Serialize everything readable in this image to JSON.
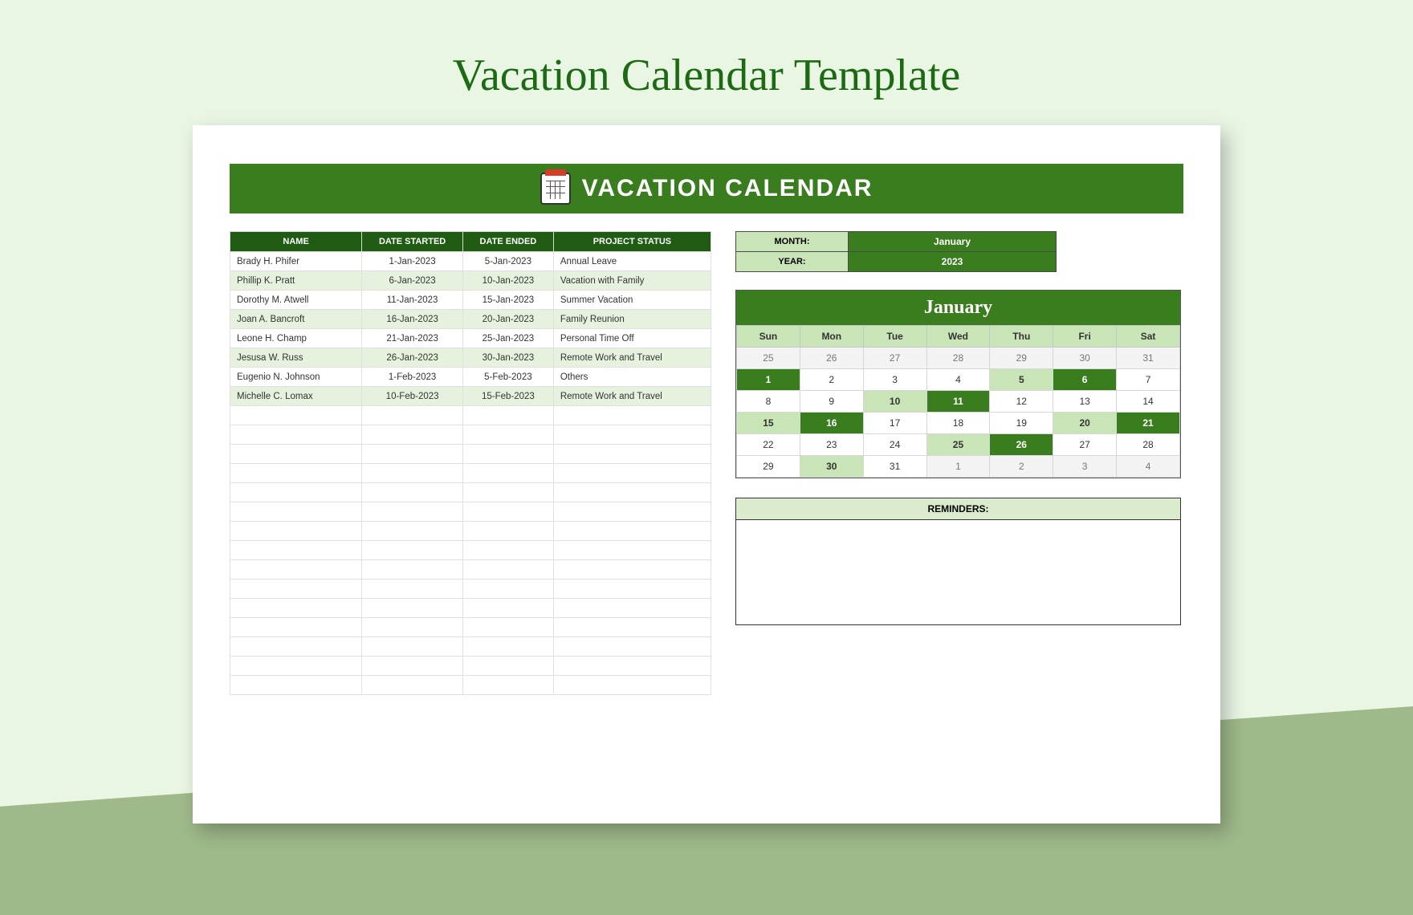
{
  "page_title": "Vacation Calendar Template",
  "banner_title": "VACATION CALENDAR",
  "table": {
    "headers": [
      "NAME",
      "DATE STARTED",
      "DATE ENDED",
      "PROJECT STATUS"
    ],
    "rows": [
      {
        "name": "Brady H. Phifer",
        "start": "1-Jan-2023",
        "end": "5-Jan-2023",
        "status": "Annual Leave"
      },
      {
        "name": "Phillip K. Pratt",
        "start": "6-Jan-2023",
        "end": "10-Jan-2023",
        "status": "Vacation with Family"
      },
      {
        "name": "Dorothy M. Atwell",
        "start": "11-Jan-2023",
        "end": "15-Jan-2023",
        "status": "Summer Vacation"
      },
      {
        "name": "Joan A. Bancroft",
        "start": "16-Jan-2023",
        "end": "20-Jan-2023",
        "status": "Family Reunion"
      },
      {
        "name": "Leone H. Champ",
        "start": "21-Jan-2023",
        "end": "25-Jan-2023",
        "status": "Personal Time Off"
      },
      {
        "name": "Jesusa W. Russ",
        "start": "26-Jan-2023",
        "end": "30-Jan-2023",
        "status": "Remote Work and Travel"
      },
      {
        "name": "Eugenio N. Johnson",
        "start": "1-Feb-2023",
        "end": "5-Feb-2023",
        "status": "Others"
      },
      {
        "name": "Michelle C. Lomax",
        "start": "10-Feb-2023",
        "end": "15-Feb-2023",
        "status": "Remote Work and Travel"
      }
    ],
    "empty_rows": 15
  },
  "meta": {
    "month_label": "MONTH:",
    "month_value": "January",
    "year_label": "YEAR:",
    "year_value": "2023"
  },
  "calendar": {
    "title": "January",
    "weekdays": [
      "Sun",
      "Mon",
      "Tue",
      "Wed",
      "Thu",
      "Fri",
      "Sat"
    ],
    "grid": [
      [
        {
          "d": "25",
          "cls": "dim"
        },
        {
          "d": "26",
          "cls": "dim"
        },
        {
          "d": "27",
          "cls": "dim"
        },
        {
          "d": "28",
          "cls": "dim"
        },
        {
          "d": "29",
          "cls": "dim"
        },
        {
          "d": "30",
          "cls": "dim"
        },
        {
          "d": "31",
          "cls": "dim"
        }
      ],
      [
        {
          "d": "1",
          "cls": "hl-dark"
        },
        {
          "d": "2",
          "cls": ""
        },
        {
          "d": "3",
          "cls": ""
        },
        {
          "d": "4",
          "cls": ""
        },
        {
          "d": "5",
          "cls": "hl-light"
        },
        {
          "d": "6",
          "cls": "hl-dark"
        },
        {
          "d": "7",
          "cls": ""
        }
      ],
      [
        {
          "d": "8",
          "cls": ""
        },
        {
          "d": "9",
          "cls": ""
        },
        {
          "d": "10",
          "cls": "hl-light"
        },
        {
          "d": "11",
          "cls": "hl-dark"
        },
        {
          "d": "12",
          "cls": ""
        },
        {
          "d": "13",
          "cls": ""
        },
        {
          "d": "14",
          "cls": ""
        }
      ],
      [
        {
          "d": "15",
          "cls": "hl-light"
        },
        {
          "d": "16",
          "cls": "hl-dark"
        },
        {
          "d": "17",
          "cls": ""
        },
        {
          "d": "18",
          "cls": ""
        },
        {
          "d": "19",
          "cls": ""
        },
        {
          "d": "20",
          "cls": "hl-light"
        },
        {
          "d": "21",
          "cls": "hl-dark"
        }
      ],
      [
        {
          "d": "22",
          "cls": ""
        },
        {
          "d": "23",
          "cls": ""
        },
        {
          "d": "24",
          "cls": ""
        },
        {
          "d": "25",
          "cls": "hl-light"
        },
        {
          "d": "26",
          "cls": "hl-dark"
        },
        {
          "d": "27",
          "cls": ""
        },
        {
          "d": "28",
          "cls": ""
        }
      ],
      [
        {
          "d": "29",
          "cls": ""
        },
        {
          "d": "30",
          "cls": "hl-light"
        },
        {
          "d": "31",
          "cls": ""
        },
        {
          "d": "1",
          "cls": "dim"
        },
        {
          "d": "2",
          "cls": "dim"
        },
        {
          "d": "3",
          "cls": "dim"
        },
        {
          "d": "4",
          "cls": "dim"
        }
      ]
    ]
  },
  "reminders_label": "REMINDERS:"
}
